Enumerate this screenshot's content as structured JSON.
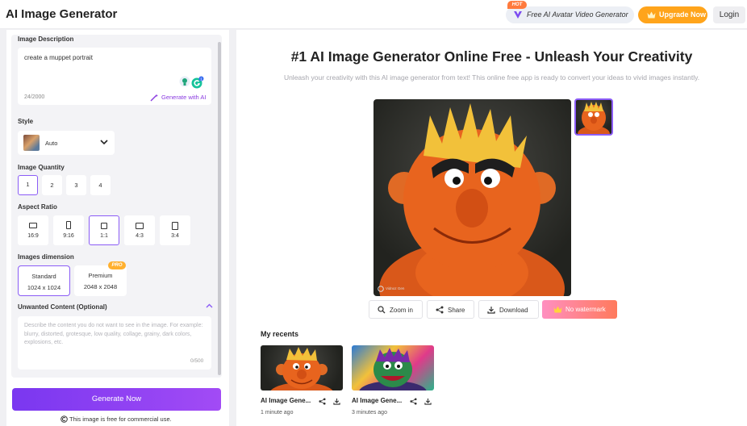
{
  "header": {
    "logo": "AI Image Generator",
    "hot_badge": "HOT",
    "avatar_video_label": "Free AI Avatar Video Generator",
    "upgrade_label": "Upgrade Now",
    "login_label": "Login"
  },
  "form": {
    "description": {
      "label": "Image Description",
      "value": "create a muppet portrait",
      "count": "24/2000",
      "generate_ai_label": "Generate with AI"
    },
    "style": {
      "label": "Style",
      "selected": "Auto"
    },
    "quantity": {
      "label": "Image Quantity",
      "options": [
        "1",
        "2",
        "3",
        "4"
      ],
      "selected": "1"
    },
    "aspect": {
      "label": "Aspect Ratio",
      "options": [
        "16:9",
        "9:16",
        "1:1",
        "4:3",
        "3:4"
      ],
      "selected": "1:1"
    },
    "dimension": {
      "label": "Images dimension",
      "pro_badge": "PRO",
      "options": [
        {
          "name": "Standard",
          "size": "1024 x 1024"
        },
        {
          "name": "Premium",
          "size": "2048 x 2048"
        }
      ],
      "selected": "Standard"
    },
    "unwanted": {
      "label": "Unwanted Content (Optional)",
      "placeholder": "Describe the content you do not want to see in the image. For example: blurry, distorted, grotesque, low quality, collage, grainy, dark colors, explosions, etc.",
      "count": "0/500"
    },
    "generate_label": "Generate Now",
    "free_note": "This image is free for commercial use."
  },
  "main": {
    "title": "#1 AI Image Generator Online Free - Unleash Your Creativity",
    "subtitle": "Unleash your creativity with this AI image generator from text! This online free app is ready to convert your ideas to vivid images instantly.",
    "watermark": "Vidnoz Gen",
    "actions": {
      "zoom_in": "Zoom in",
      "share": "Share",
      "download": "Download",
      "no_watermark": "No watermark"
    },
    "recents": {
      "label": "My recents",
      "items": [
        {
          "title": "AI Image Gene...",
          "time": "1 minute ago"
        },
        {
          "title": "AI Image Gene...",
          "time": "3 minutes ago"
        }
      ]
    }
  },
  "colors": {
    "accent": "#8b5cf6",
    "generate_gradient_start": "#7a37f0",
    "upgrade": "#ffa41b",
    "muppet_orange": "#e8641e"
  },
  "icons": [
    "crown-icon",
    "avatar-logo-icon",
    "magic-wand-icon",
    "grammarly-icon",
    "chevron-down-icon",
    "chevron-up-icon",
    "copyright-icon",
    "zoom-icon",
    "share-icon",
    "download-icon"
  ]
}
